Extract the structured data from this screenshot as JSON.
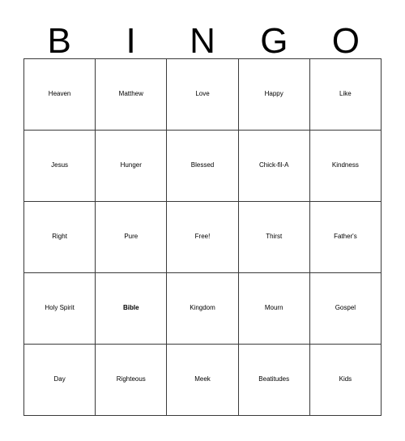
{
  "card": {
    "type": "bingo-card",
    "header_letters": [
      "B",
      "I",
      "N",
      "G",
      "O"
    ],
    "grid_size": "5x5",
    "colors": {
      "background": "#ffffff",
      "text": "#000000",
      "grid_line": "#3a3a3a"
    },
    "rows": [
      [
        {
          "text": "Heaven",
          "size": "m",
          "bold": false
        },
        {
          "text": "Matthew",
          "size": "s",
          "bold": false
        },
        {
          "text": "Love",
          "size": "xxl",
          "bold": false
        },
        {
          "text": "Happy",
          "size": "m",
          "bold": false
        },
        {
          "text": "Like",
          "size": "xxl",
          "bold": false
        }
      ],
      [
        {
          "text": "Jesus",
          "size": "xxl",
          "bold": false
        },
        {
          "text": "Hunger",
          "size": "m",
          "bold": false
        },
        {
          "text": "Blessed",
          "size": "s",
          "bold": false
        },
        {
          "text": "Chick-fil-A",
          "size": "l",
          "bold": false
        },
        {
          "text": "Kindness",
          "size": "xxs",
          "bold": false
        }
      ],
      [
        {
          "text": "Right",
          "size": "xxl",
          "bold": false
        },
        {
          "text": "Pure",
          "size": "xxl",
          "bold": false
        },
        {
          "text": "Free!",
          "size": "xxl",
          "bold": false
        },
        {
          "text": "Thirst",
          "size": "l",
          "bold": false
        },
        {
          "text": "Father's",
          "size": "xxs",
          "bold": false
        }
      ],
      [
        {
          "text": "Holy Spirit",
          "size": "l",
          "bold": false
        },
        {
          "text": "Bible",
          "size": "xl",
          "bold": true
        },
        {
          "text": "Kingdom",
          "size": "xs",
          "bold": false
        },
        {
          "text": "Mourn",
          "size": "l",
          "bold": false
        },
        {
          "text": "Gospel",
          "size": "m",
          "bold": false
        }
      ],
      [
        {
          "text": "Day",
          "size": "xxl",
          "bold": false
        },
        {
          "text": "Righteous",
          "size": "xxs",
          "bold": false
        },
        {
          "text": "Meek",
          "size": "xxl",
          "bold": false
        },
        {
          "text": "Beatitudes",
          "size": "tiny",
          "bold": false
        },
        {
          "text": "Kids",
          "size": "xxl",
          "bold": false
        }
      ]
    ]
  }
}
